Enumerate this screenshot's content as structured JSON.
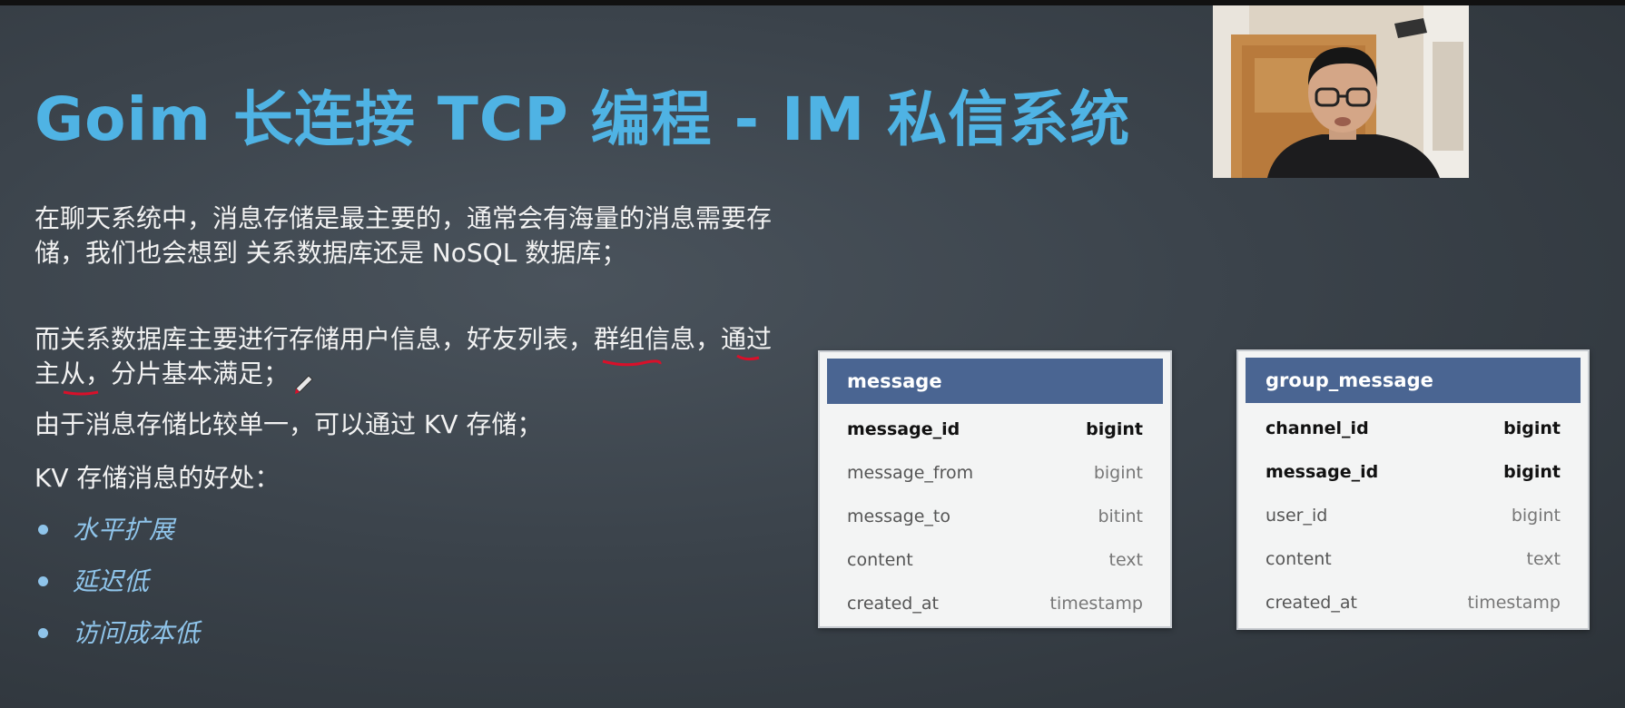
{
  "slide": {
    "title": "Goim 长连接 TCP 编程 - IM 私信系统",
    "paragraphs": [
      "在聊天系统中，消息存储是最主要的，通常会有海量的消息需要存储，我们也会想到 关系数据库还是 NoSQL 数据库；",
      "而关系数据库主要进行存储用户信息，好友列表，群组信息，通过主从，分片基本满足；",
      "由于消息存储比较单一，可以通过 KV 存储；",
      "KV 存储消息的好处："
    ],
    "bullets": [
      "水平扩展",
      "延迟低",
      "访问成本低"
    ]
  },
  "tables": [
    {
      "name": "message",
      "rows": [
        {
          "column": "message_id",
          "type": "bigint",
          "key": true
        },
        {
          "column": "message_from",
          "type": "bigint",
          "key": false
        },
        {
          "column": "message_to",
          "type": "bitint",
          "key": false
        },
        {
          "column": "content",
          "type": "text",
          "key": false
        },
        {
          "column": "created_at",
          "type": "timestamp",
          "key": false
        }
      ]
    },
    {
      "name": "group_message",
      "rows": [
        {
          "column": "channel_id",
          "type": "bigint",
          "key": true
        },
        {
          "column": "message_id",
          "type": "bigint",
          "key": true
        },
        {
          "column": "user_id",
          "type": "bigint",
          "key": false
        },
        {
          "column": "content",
          "type": "text",
          "key": false
        },
        {
          "column": "created_at",
          "type": "timestamp",
          "key": false
        }
      ]
    }
  ],
  "colors": {
    "title": "#4fb3e4",
    "table_header": "#4a6592",
    "bullet": "#8fc4ea",
    "annotation": "#d8102a"
  },
  "icons": [
    "pen-cursor-icon",
    "bullet-dot-icon"
  ]
}
